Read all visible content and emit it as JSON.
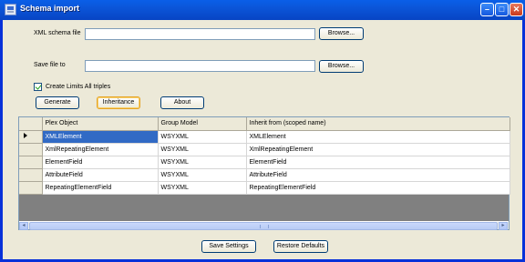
{
  "window": {
    "title": "Schema import"
  },
  "titlebar": {
    "minimize_glyph": "–",
    "maximize_glyph": "□",
    "close_glyph": "✕"
  },
  "form": {
    "xml_schema_label": "XML schema file",
    "xml_schema_value": "",
    "save_file_label": "Save file to",
    "save_file_value": "",
    "browse_label": "Browse...",
    "create_limits_label": "Create Limits All triples",
    "create_limits_checked": true
  },
  "actions": {
    "generate": "Generate",
    "inheritance": "Inheritance",
    "about": "About"
  },
  "grid": {
    "columns": [
      "Plex Object",
      "Group Model",
      "Inherit from (scoped name)"
    ],
    "rows": [
      [
        "XMLElement",
        "WSYXML",
        "XMLElement"
      ],
      [
        "XmlRepeatingElement",
        "WSYXML",
        "XmlRepeatingElement"
      ],
      [
        "ElementField",
        "WSYXML",
        "ElementField"
      ],
      [
        "AttributeField",
        "WSYXML",
        "AttributeField"
      ],
      [
        "RepeatingElementField",
        "WSYXML",
        "RepeatingElementField"
      ]
    ],
    "selected_row": 0
  },
  "scrollbar": {
    "left_glyph": "◂",
    "right_glyph": "▸"
  },
  "footer": {
    "save_settings": "Save Settings",
    "restore_defaults": "Restore Defaults"
  }
}
